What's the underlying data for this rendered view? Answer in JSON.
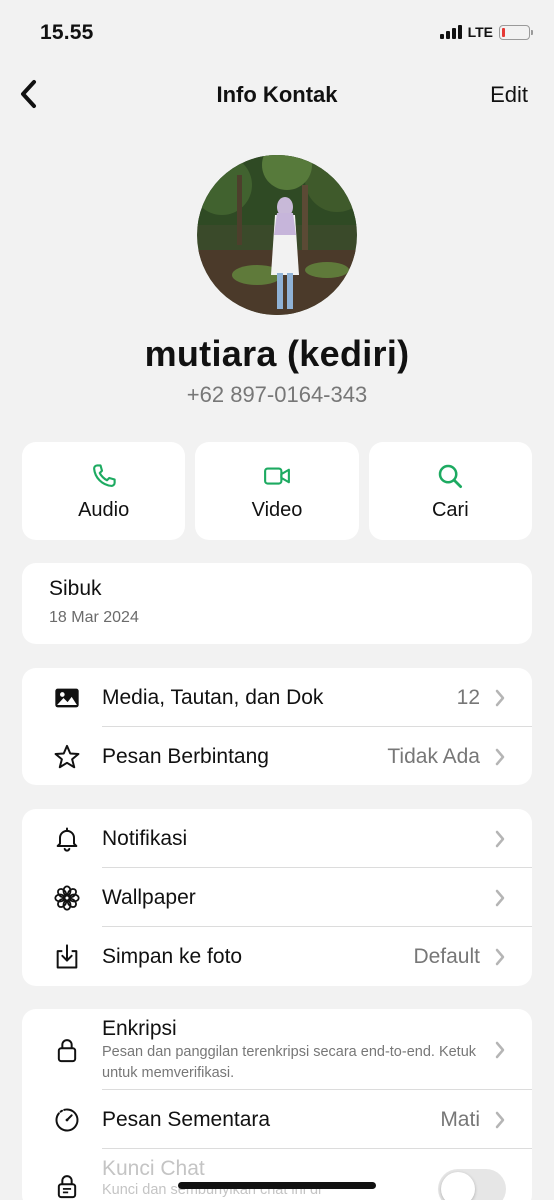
{
  "status": {
    "time": "15.55",
    "network": "LTE",
    "battery_color": "#e53935"
  },
  "nav": {
    "title": "Info Kontak",
    "edit_label": "Edit"
  },
  "contact": {
    "name": "mutiara (kediri)",
    "phone": "+62 897-0164-343"
  },
  "actions": [
    {
      "label": "Audio",
      "icon": "phone-icon"
    },
    {
      "label": "Video",
      "icon": "video-camera-icon"
    },
    {
      "label": "Cari",
      "icon": "search-icon"
    }
  ],
  "about": {
    "text": "Sibuk",
    "date": "18 Mar 2024"
  },
  "media_rows": [
    {
      "label": "Media, Tautan, dan Dok",
      "value": "12",
      "icon": "photo-icon"
    },
    {
      "label": "Pesan Berbintang",
      "value": "Tidak Ada",
      "icon": "star-icon"
    }
  ],
  "settings_rows": [
    {
      "label": "Notifikasi",
      "value": "",
      "icon": "bell-icon"
    },
    {
      "label": "Wallpaper",
      "value": "",
      "icon": "flower-icon"
    },
    {
      "label": "Simpan ke foto",
      "value": "Default",
      "icon": "download-icon"
    }
  ],
  "security": {
    "encryption_label": "Enkripsi",
    "encryption_sub": "Pesan dan panggilan terenkripsi secara end-to-end. Ketuk untuk memverifikasi.",
    "disappearing_label": "Pesan Sementara",
    "disappearing_value": "Mati",
    "chat_lock_label": "Kunci Chat",
    "chat_lock_sub": "Kunci dan sembunyikan chat ini di",
    "chat_lock_enabled": false
  },
  "colors": {
    "accent": "#1daa61",
    "background": "#f2f2f2",
    "card": "#ffffff"
  }
}
